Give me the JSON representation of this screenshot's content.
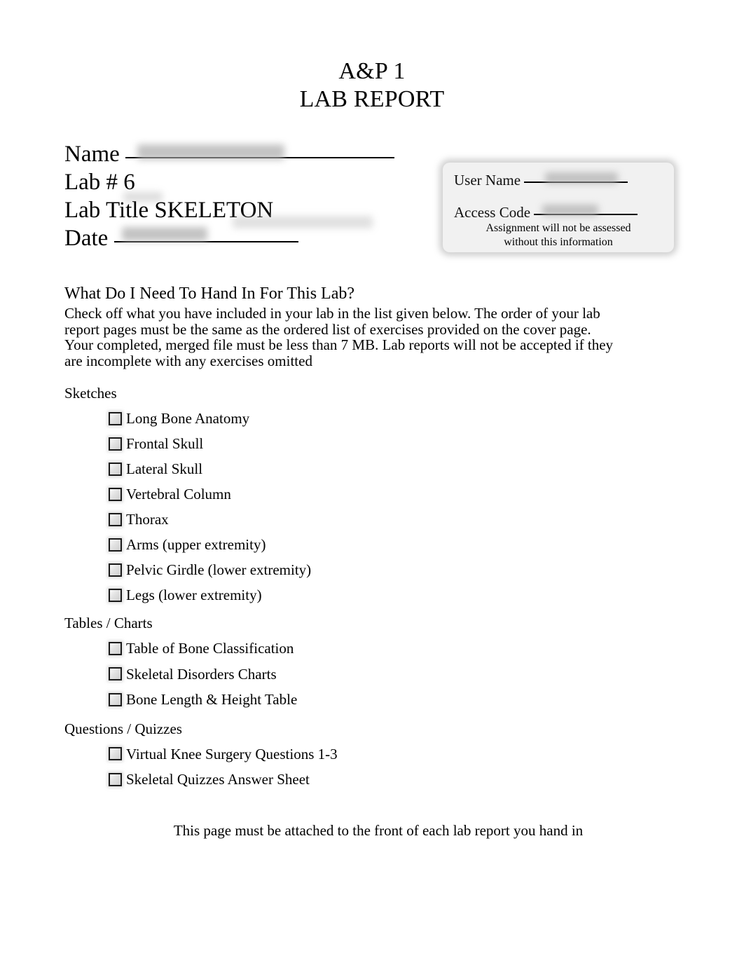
{
  "document": {
    "title_lines": [
      "A&P 1",
      "LAB REPORT"
    ]
  },
  "identification": {
    "name_label": "Name",
    "name_value": "",
    "lab_number_label": "Lab # 6",
    "lab_title_label": "Lab Title SKELETON",
    "date_label": "Date",
    "date_value": ""
  },
  "access_card": {
    "user_name_label": "User Name",
    "user_name_value": "",
    "access_code_label": "Access Code",
    "access_code_value": "",
    "note_line_1": "Assignment will not be assessed",
    "note_line_2": "without this information"
  },
  "hand_in": {
    "heading": "What Do I Need To Hand In For This Lab?",
    "body": "Check off what you have included in your lab in the list given below. The order of your lab report pages must be the same as the ordered list of exercises provided on the cover page. Your completed, merged file must be less than 7 MB. Lab reports will not be accepted if they are incomplete with any exercises omitted"
  },
  "checklist": {
    "groups": [
      {
        "title": "Sketches",
        "items": [
          {
            "label": "Long Bone Anatomy",
            "checked": false
          },
          {
            "label": "Frontal Skull",
            "checked": false
          },
          {
            "label": "Lateral Skull",
            "checked": false
          },
          {
            "label": "Vertebral Column",
            "checked": false
          },
          {
            "label": "Thorax",
            "checked": false
          },
          {
            "label": "Arms (upper extremity)",
            "checked": false
          },
          {
            "label": "Pelvic Girdle (lower extremity)",
            "checked": false
          },
          {
            "label": "Legs (lower extremity)",
            "checked": false
          }
        ]
      },
      {
        "title": "Tables / Charts",
        "items": [
          {
            "label": "Table of Bone Classification",
            "checked": false
          },
          {
            "label": "Skeletal Disorders Charts",
            "checked": false
          },
          {
            "label": "Bone Length & Height Table",
            "checked": false
          }
        ]
      },
      {
        "title": "Questions / Quizzes",
        "items": [
          {
            "label": "Virtual Knee Surgery Questions 1-3",
            "checked": false
          },
          {
            "label": "Skeletal Quizzes Answer Sheet",
            "checked": false
          }
        ]
      }
    ]
  },
  "footer": {
    "note": "This page must be attached to the front of each lab report you hand in"
  },
  "colors": {
    "page_background": "#ffffff",
    "text": "#000000",
    "card_background": "#f1f1f1",
    "checkbox_border": "#1a1a1a",
    "redaction": "#b4b4b4"
  }
}
